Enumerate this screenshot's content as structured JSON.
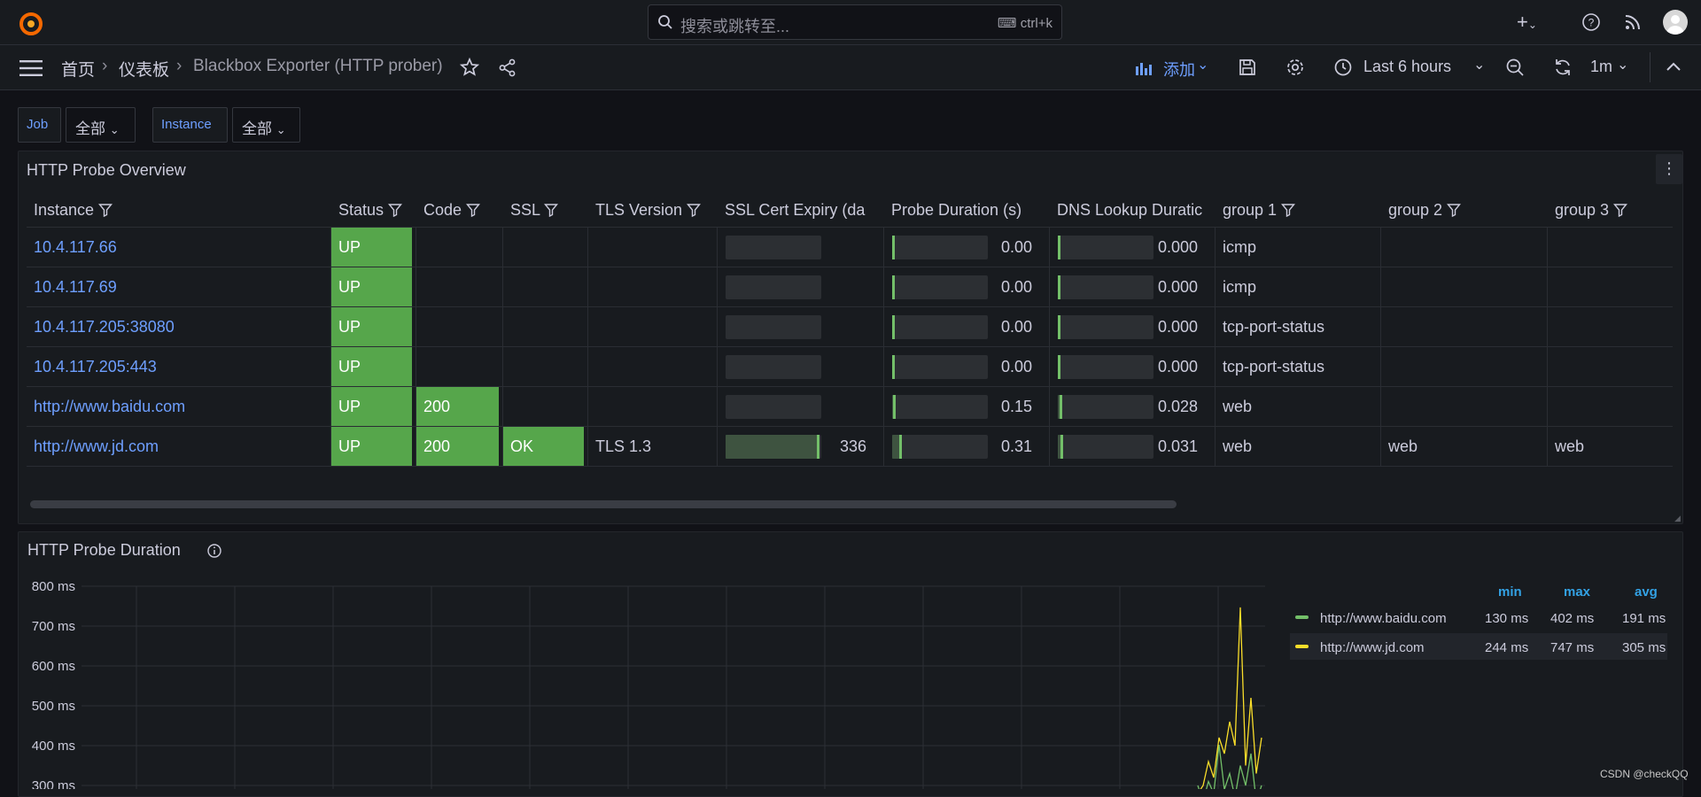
{
  "topbar": {
    "search_placeholder": "搜索或跳转至...",
    "search_shortcut": "ctrl+k"
  },
  "nav": {
    "breadcrumb": [
      "首页",
      "仪表板",
      "Blackbox Exporter (HTTP prober)"
    ],
    "add_label": "添加",
    "time_range": "Last 6 hours",
    "refresh_interval": "1m"
  },
  "variables": [
    {
      "label": "Job",
      "value": "全部"
    },
    {
      "label": "Instance",
      "value": "全部"
    }
  ],
  "table_panel": {
    "title": "HTTP Probe Overview",
    "columns": [
      "Instance",
      "Status",
      "Code",
      "SSL",
      "TLS Version",
      "SSL Cert Expiry (da",
      "Probe Duration (s)",
      "DNS Lookup Duratic",
      "group 1",
      "group 2",
      "group 3"
    ],
    "rows": [
      {
        "instance": "10.4.117.66",
        "status": "UP",
        "code": "",
        "ssl": "",
        "tls": "",
        "expiry": "",
        "expiry_frac": 0,
        "probe": "0.00",
        "probe_frac": 0.0,
        "dns": "0.000",
        "dns_frac": 0.0,
        "g1": "icmp",
        "g2": "",
        "g3": ""
      },
      {
        "instance": "10.4.117.69",
        "status": "UP",
        "code": "",
        "ssl": "",
        "tls": "",
        "expiry": "",
        "expiry_frac": 0,
        "probe": "0.00",
        "probe_frac": 0.0,
        "dns": "0.000",
        "dns_frac": 0.0,
        "g1": "icmp",
        "g2": "",
        "g3": ""
      },
      {
        "instance": "10.4.117.205:38080",
        "status": "UP",
        "code": "",
        "ssl": "",
        "tls": "",
        "expiry": "",
        "expiry_frac": 0,
        "probe": "0.00",
        "probe_frac": 0.0,
        "dns": "0.000",
        "dns_frac": 0.0,
        "g1": "tcp-port-status",
        "g2": "",
        "g3": ""
      },
      {
        "instance": "10.4.117.205:443",
        "status": "UP",
        "code": "",
        "ssl": "",
        "tls": "",
        "expiry": "",
        "expiry_frac": 0,
        "probe": "0.00",
        "probe_frac": 0.0,
        "dns": "0.000",
        "dns_frac": 0.0,
        "g1": "tcp-port-status",
        "g2": "",
        "g3": ""
      },
      {
        "instance": "http://www.baidu.com",
        "status": "UP",
        "code": "200",
        "ssl": "",
        "tls": "",
        "expiry": "",
        "expiry_frac": 0,
        "probe": "0.15",
        "probe_frac": 0.04,
        "dns": "0.028",
        "dns_frac": 0.05,
        "g1": "web",
        "g2": "",
        "g3": ""
      },
      {
        "instance": "http://www.jd.com",
        "status": "UP",
        "code": "200",
        "ssl": "OK",
        "tls": "TLS 1.3",
        "expiry": "336",
        "expiry_frac": 0.98,
        "probe": "0.31",
        "probe_frac": 0.1,
        "dns": "0.031",
        "dns_frac": 0.06,
        "g1": "web",
        "g2": "web",
        "g3": "web"
      }
    ],
    "colors": {
      "status_green": "#56a64b",
      "gauge_green": "#73bf69"
    }
  },
  "chart_panel": {
    "title": "HTTP Probe Duration"
  },
  "chart_data": {
    "type": "line",
    "title": "HTTP Probe Duration",
    "y_tick_labels": [
      "800 ms",
      "700 ms",
      "600 ms",
      "500 ms",
      "400 ms",
      "300 ms"
    ],
    "ylim": [
      300,
      800
    ],
    "grid": true,
    "legend_placement": "right",
    "legend_headers": [
      "min",
      "max",
      "avg"
    ],
    "series": [
      {
        "name": "http://www.baidu.com",
        "color": "#73bf69",
        "min": "130 ms",
        "max": "402 ms",
        "avg": "191 ms"
      },
      {
        "name": "http://www.jd.com",
        "color": "#fade2a",
        "min": "244 ms",
        "max": "747 ms",
        "avg": "305 ms"
      }
    ]
  },
  "watermark": "CSDN @checkQQ"
}
